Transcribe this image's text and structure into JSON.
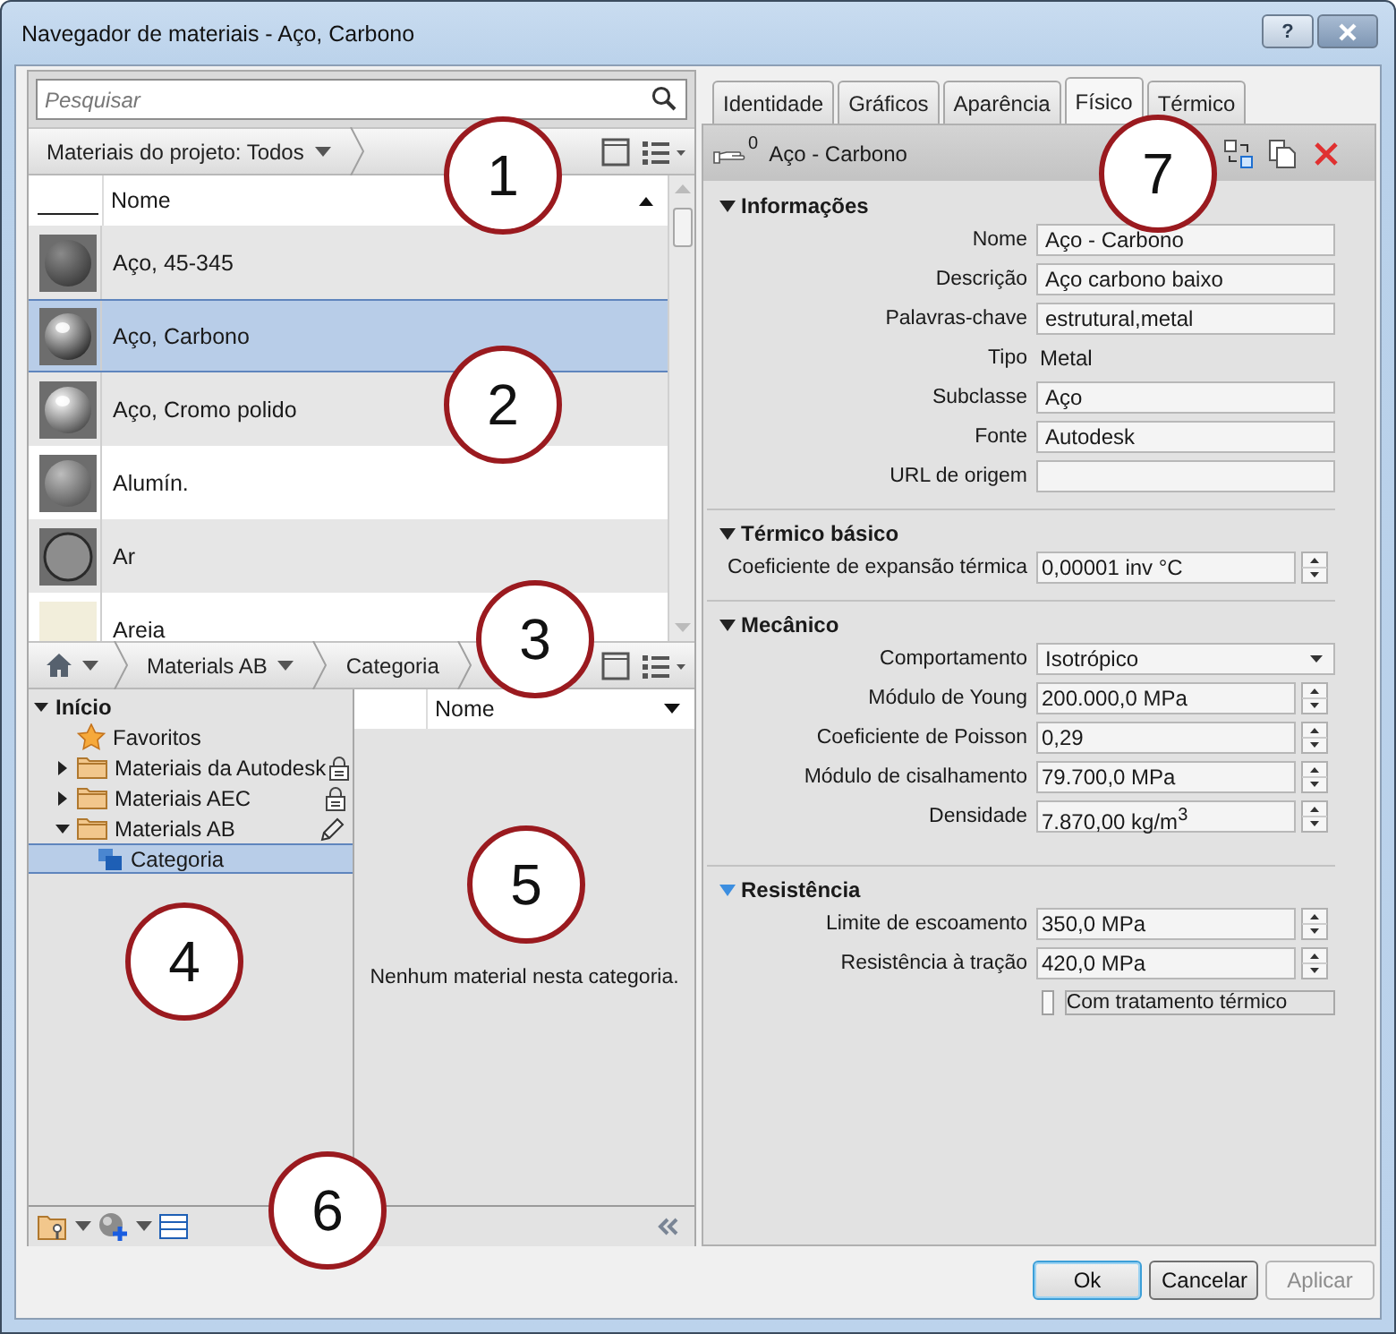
{
  "window": {
    "title": "Navegador de materiais - Aço, Carbono",
    "help_label": "?"
  },
  "search": {
    "placeholder": "Pesquisar"
  },
  "library_bar": {
    "filter": "Materiais do projeto: Todos"
  },
  "material_table": {
    "columns": [
      "Nome"
    ],
    "rows": [
      {
        "name": "Aço, 45-345",
        "kind": "matte",
        "selected": false
      },
      {
        "name": "Aço, Carbono",
        "kind": "glossy",
        "selected": true
      },
      {
        "name": "Aço, Cromo polido",
        "kind": "chrome",
        "selected": false
      },
      {
        "name": "Alumín.",
        "kind": "satin",
        "selected": false
      },
      {
        "name": "Ar",
        "kind": "glass",
        "selected": false
      },
      {
        "name": "Areia",
        "kind": "sand",
        "selected": false
      }
    ]
  },
  "library_nav": {
    "crumbs": [
      {
        "label": "Materials AB",
        "menu": true
      },
      {
        "label": "Categoria",
        "menu": false
      }
    ]
  },
  "library_tree": [
    {
      "label": "Início",
      "kind": "root",
      "expanded": true,
      "selected": false,
      "children": [
        {
          "label": "Favoritos",
          "kind": "favorites",
          "selected": false
        },
        {
          "label": "Materiais da Autodesk",
          "kind": "folder",
          "expanded": false,
          "locked": true,
          "selected": false
        },
        {
          "label": "Materiais AEC",
          "kind": "folder",
          "expanded": false,
          "locked": true,
          "selected": false
        },
        {
          "label": "Materials AB",
          "kind": "folder",
          "expanded": true,
          "editable": true,
          "selected": false,
          "children": [
            {
              "label": "Categoria",
              "kind": "category",
              "selected": true
            }
          ]
        }
      ]
    }
  ],
  "category_list": {
    "columns": [
      "Nome"
    ],
    "empty_message": "Nenhum material nesta categoria."
  },
  "tabs": [
    {
      "label": "Identidade",
      "selected": false
    },
    {
      "label": "Gráficos",
      "selected": false
    },
    {
      "label": "Aparência",
      "selected": false
    },
    {
      "label": "Físico",
      "selected": true
    },
    {
      "label": "Térmico",
      "selected": false
    }
  ],
  "asset": {
    "count": "0",
    "name": "Aço - Carbono"
  },
  "sections": [
    {
      "title": "Informações",
      "expanded": true,
      "highlighted": false,
      "fields": [
        {
          "label": "Nome",
          "kind": "text",
          "value": "Aço - Carbono"
        },
        {
          "label": "Descrição",
          "kind": "text",
          "value": "Aço carbono baixo"
        },
        {
          "label": "Palavras-chave",
          "kind": "text",
          "value": "estrutural,metal"
        },
        {
          "label": "Tipo",
          "kind": "static",
          "value": "Metal"
        },
        {
          "label": "Subclasse",
          "kind": "text",
          "value": "Aço"
        },
        {
          "label": "Fonte",
          "kind": "text",
          "value": "Autodesk"
        },
        {
          "label": "URL de origem",
          "kind": "text"
        }
      ]
    },
    {
      "title": "Térmico básico",
      "expanded": true,
      "highlighted": false,
      "fields": [
        {
          "label": "Coeficiente de expansão térmica",
          "kind": "spinner",
          "value": "0,00001 inv °C"
        }
      ]
    },
    {
      "title": "Mecânico",
      "expanded": true,
      "highlighted": false,
      "fields": [
        {
          "label": "Comportamento",
          "kind": "dropdown",
          "value": "Isotrópico"
        },
        {
          "label": "Módulo de Young",
          "kind": "spinner",
          "value": "200.000,0 MPa"
        },
        {
          "label": "Coeficiente de Poisson",
          "kind": "spinner",
          "value": "0,29"
        },
        {
          "label": "Módulo de cisalhamento",
          "kind": "spinner",
          "value": "79.700,0 MPa"
        },
        {
          "label": "Densidade",
          "kind": "spinner",
          "value": "7.870,00 kg/m$^{3}$"
        }
      ]
    },
    {
      "title": "Resistência",
      "expanded": true,
      "highlighted": true,
      "fields": [
        {
          "label": "Limite de escoamento",
          "kind": "spinner",
          "value": "350,0 MPa"
        },
        {
          "label": "Resistência à tração",
          "kind": "spinner",
          "value": "420,0 MPa"
        },
        {
          "label": "Com tratamento térmico",
          "kind": "checkbox",
          "checked": false
        }
      ]
    }
  ],
  "buttons": [
    {
      "label": "Ok",
      "default": true,
      "disabled": false
    },
    {
      "label": "Cancelar",
      "default": false,
      "disabled": false
    },
    {
      "label": "Aplicar",
      "default": false,
      "disabled": true
    }
  ],
  "callouts": [
    {
      "label": "1"
    },
    {
      "label": "2"
    },
    {
      "label": "3"
    },
    {
      "label": "4"
    },
    {
      "label": "5"
    },
    {
      "label": "6"
    },
    {
      "label": "7"
    }
  ]
}
